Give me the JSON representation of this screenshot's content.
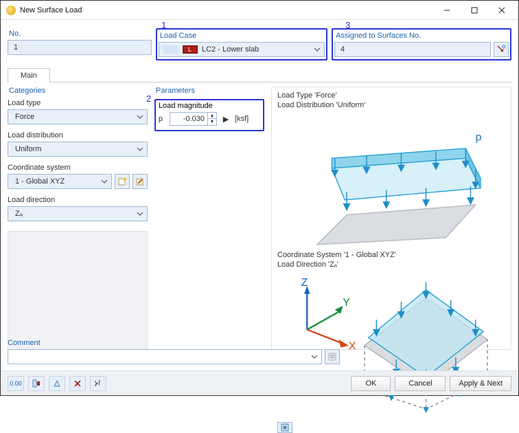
{
  "window": {
    "title": "New Surface Load"
  },
  "header": {
    "no_label": "No.",
    "no_value": "1",
    "load_case_label": "Load Case",
    "load_case_value": "LC2 - Lower slab",
    "assigned_label": "Assigned to Surfaces No.",
    "assigned_value": "4"
  },
  "annotations": {
    "a1": "1",
    "a2": "2",
    "a3": "3"
  },
  "tabs": {
    "main": "Main"
  },
  "categories": {
    "title": "Categories",
    "load_type_label": "Load type",
    "load_type_value": "Force",
    "load_distribution_label": "Load distribution",
    "load_distribution_value": "Uniform",
    "coord_label": "Coordinate system",
    "coord_value": "1 - Global XYZ",
    "load_direction_label": "Load direction",
    "load_direction_value": "Zₐ"
  },
  "parameters": {
    "title": "Parameters",
    "magnitude_label": "Load magnitude",
    "symbol": "p",
    "value": "-0.030",
    "unit": "[ksf]"
  },
  "preview": {
    "line1a": "Load Type 'Force'",
    "line1b": "Load Distribution 'Uniform'",
    "p_label": "p",
    "line2a": "Coordinate System '1 - Global XYZ'",
    "line2b": "Load Direction 'Zₐ'"
  },
  "comment": {
    "label": "Comment",
    "value": ""
  },
  "buttons": {
    "ok": "OK",
    "cancel": "Cancel",
    "apply_next": "Apply & Next"
  }
}
